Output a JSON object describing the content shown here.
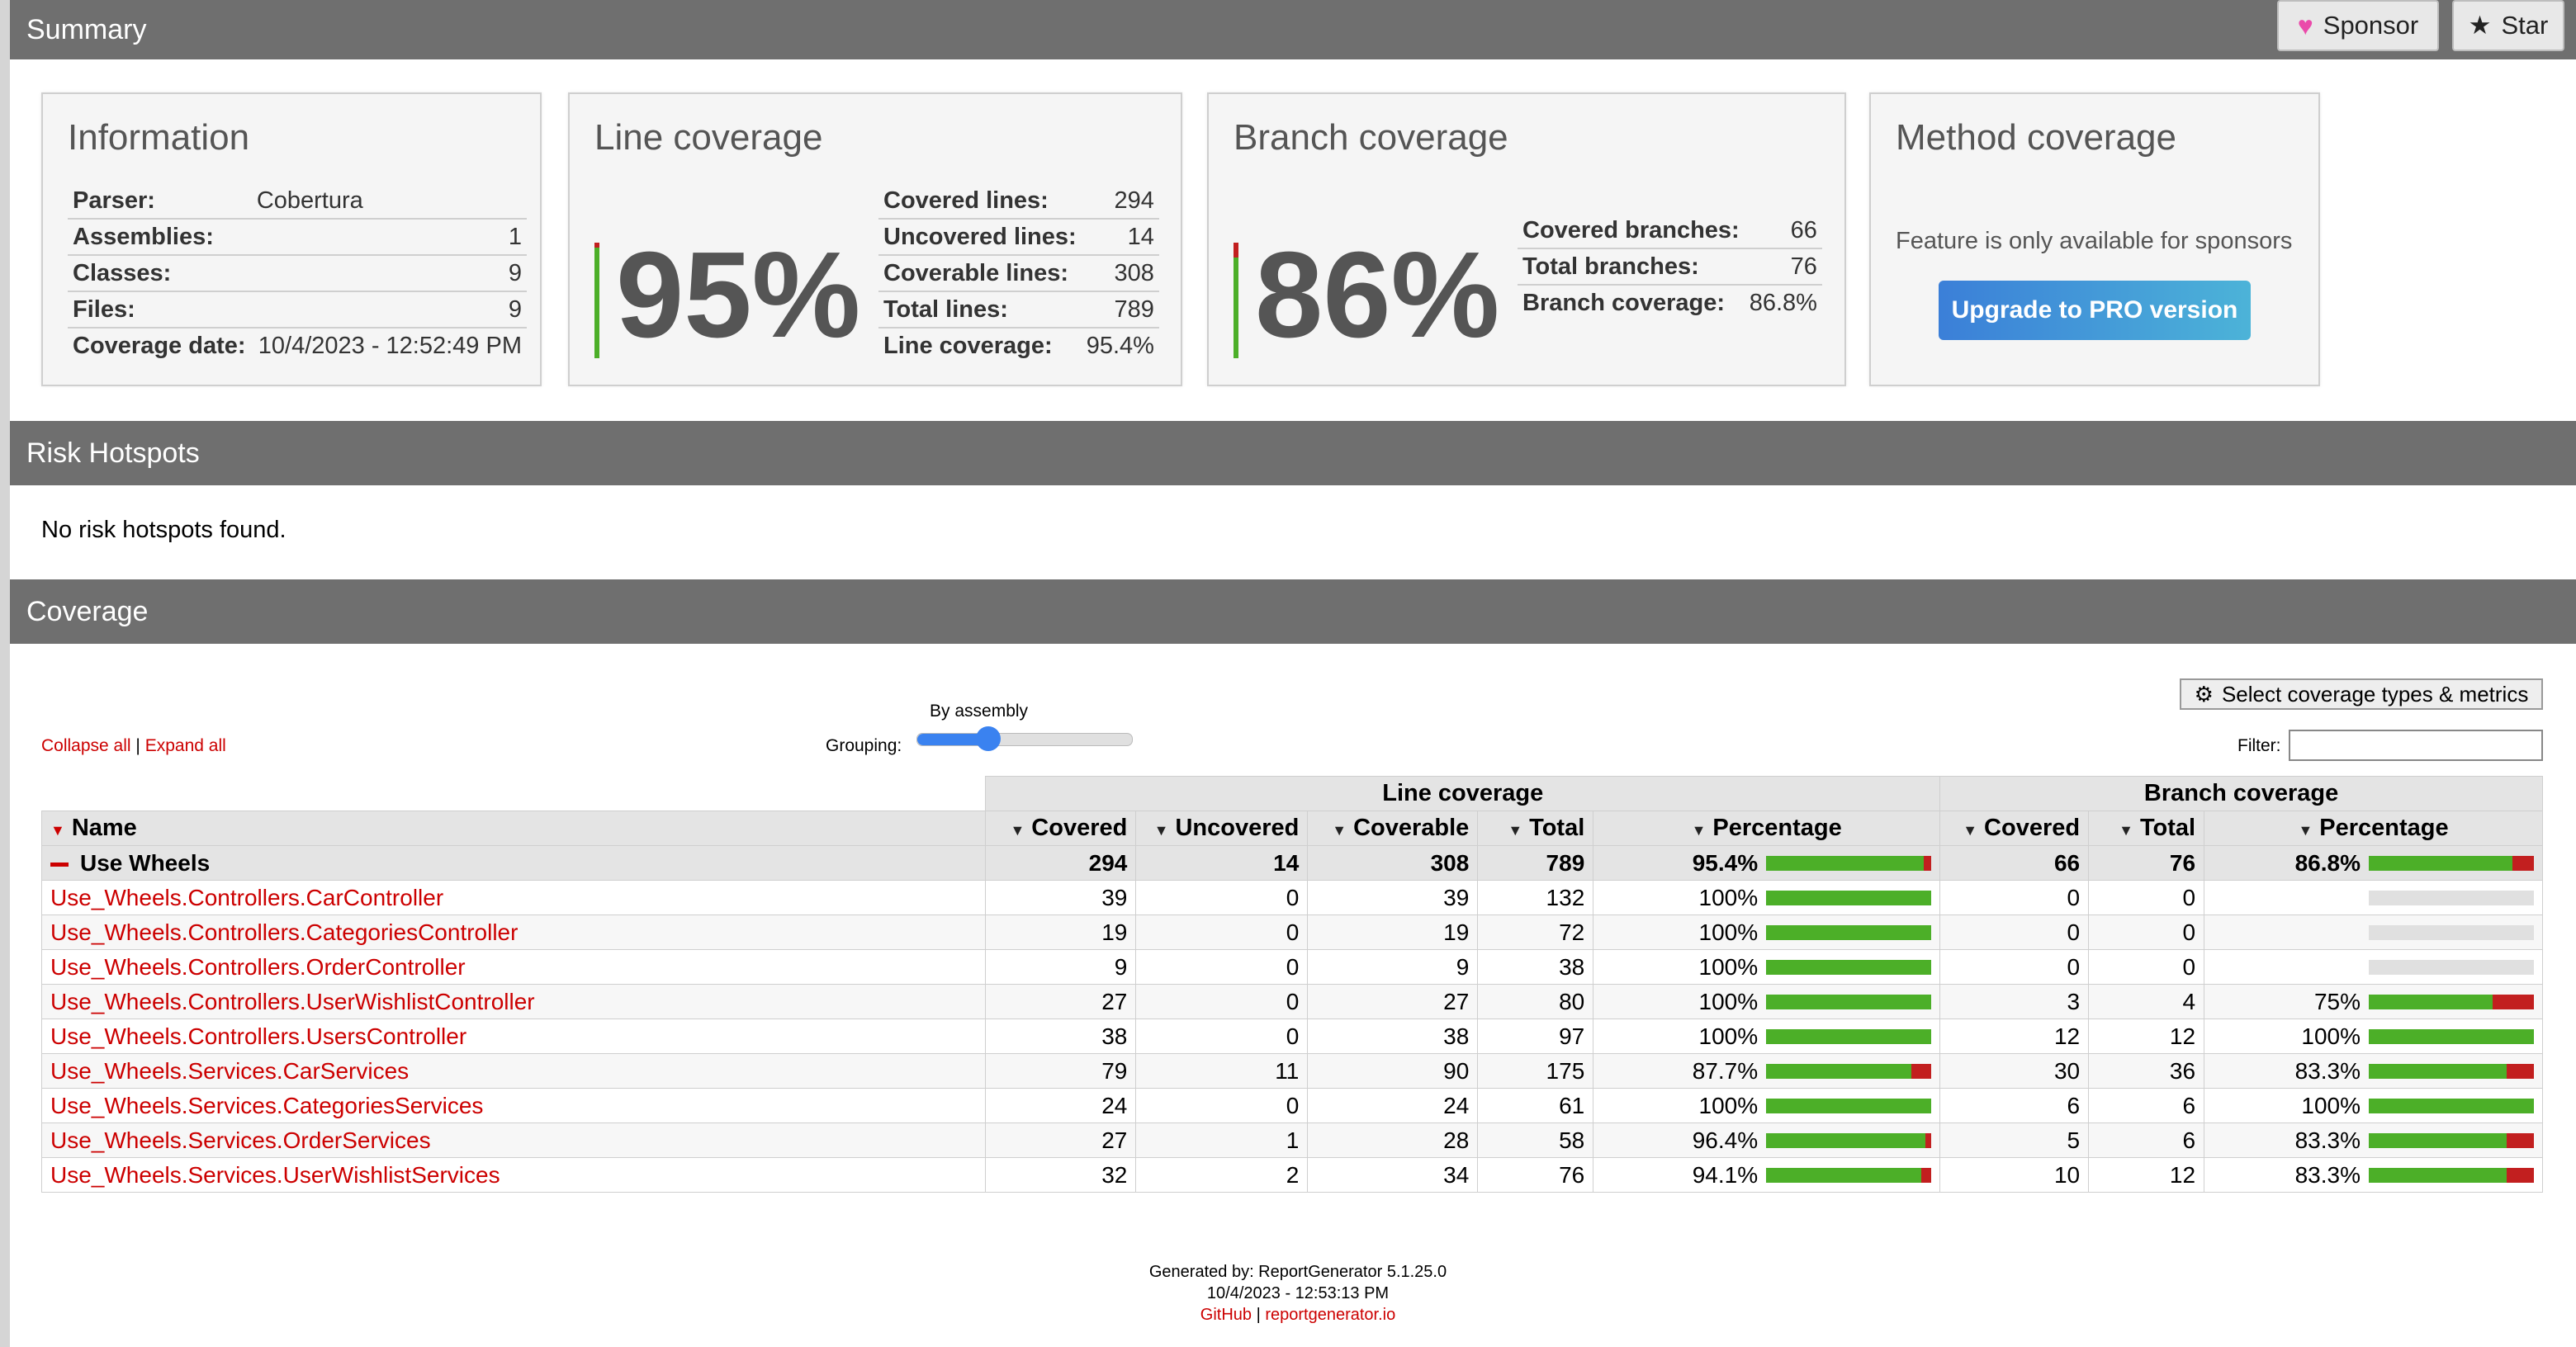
{
  "header": {
    "summary_title": "Summary",
    "sponsor_label": "Sponsor",
    "star_label": "Star",
    "risk_title": "Risk Hotspots",
    "coverage_title": "Coverage"
  },
  "information": {
    "title": "Information",
    "rows": [
      {
        "k": "Parser:",
        "v": "Cobertura"
      },
      {
        "k": "Assemblies:",
        "v": "1"
      },
      {
        "k": "Classes:",
        "v": "9"
      },
      {
        "k": "Files:",
        "v": "9"
      },
      {
        "k": "Coverage date:",
        "v": "10/4/2023 - 12:52:49 PM"
      }
    ]
  },
  "line_coverage": {
    "title": "Line coverage",
    "percent_text": "95%",
    "fraction": 0.954,
    "rows": [
      {
        "k": "Covered lines:",
        "v": "294"
      },
      {
        "k": "Uncovered lines:",
        "v": "14"
      },
      {
        "k": "Coverable lines:",
        "v": "308"
      },
      {
        "k": "Total lines:",
        "v": "789"
      },
      {
        "k": "Line coverage:",
        "v": "95.4%"
      }
    ]
  },
  "branch_coverage": {
    "title": "Branch coverage",
    "percent_text": "86%",
    "fraction": 0.868,
    "rows": [
      {
        "k": "Covered branches:",
        "v": "66"
      },
      {
        "k": "Total branches:",
        "v": "76"
      },
      {
        "k": "Branch coverage:",
        "v": "86.8%"
      }
    ]
  },
  "method_coverage": {
    "title": "Method coverage",
    "text": "Feature is only available for sponsors",
    "button": "Upgrade to PRO version"
  },
  "risk": {
    "text": "No risk hotspots found."
  },
  "controls": {
    "collapse_all": "Collapse all",
    "separator": "|",
    "expand_all": "Expand all",
    "grouping_label": "Grouping:",
    "grouping_value": "By assembly",
    "grouping_level": 0.33,
    "select_metrics": "Select coverage types & metrics",
    "filter_label": "Filter:"
  },
  "table": {
    "group_line": "Line coverage",
    "group_branch": "Branch coverage",
    "columns": [
      "Name",
      "Covered",
      "Uncovered",
      "Coverable",
      "Total",
      "Percentage",
      "Covered",
      "Total",
      "Percentage"
    ],
    "assembly": {
      "name": "Use Wheels",
      "covered": "294",
      "uncovered": "14",
      "coverable": "308",
      "total": "789",
      "pct": "95.4%",
      "line_frac": 0.954,
      "b_covered": "66",
      "b_total": "76",
      "b_pct": "86.8%",
      "branch_frac": 0.868
    },
    "rows": [
      {
        "name": "Use_Wheels.Controllers.CarController",
        "covered": "39",
        "uncovered": "0",
        "coverable": "39",
        "total": "132",
        "pct": "100%",
        "line_frac": 1.0,
        "b_covered": "0",
        "b_total": "0",
        "b_pct": "",
        "branch_frac": null
      },
      {
        "name": "Use_Wheels.Controllers.CategoriesController",
        "covered": "19",
        "uncovered": "0",
        "coverable": "19",
        "total": "72",
        "pct": "100%",
        "line_frac": 1.0,
        "b_covered": "0",
        "b_total": "0",
        "b_pct": "",
        "branch_frac": null
      },
      {
        "name": "Use_Wheels.Controllers.OrderController",
        "covered": "9",
        "uncovered": "0",
        "coverable": "9",
        "total": "38",
        "pct": "100%",
        "line_frac": 1.0,
        "b_covered": "0",
        "b_total": "0",
        "b_pct": "",
        "branch_frac": null
      },
      {
        "name": "Use_Wheels.Controllers.UserWishlistController",
        "covered": "27",
        "uncovered": "0",
        "coverable": "27",
        "total": "80",
        "pct": "100%",
        "line_frac": 1.0,
        "b_covered": "3",
        "b_total": "4",
        "b_pct": "75%",
        "branch_frac": 0.75
      },
      {
        "name": "Use_Wheels.Controllers.UsersController",
        "covered": "38",
        "uncovered": "0",
        "coverable": "38",
        "total": "97",
        "pct": "100%",
        "line_frac": 1.0,
        "b_covered": "12",
        "b_total": "12",
        "b_pct": "100%",
        "branch_frac": 1.0
      },
      {
        "name": "Use_Wheels.Services.CarServices",
        "covered": "79",
        "uncovered": "11",
        "coverable": "90",
        "total": "175",
        "pct": "87.7%",
        "line_frac": 0.877,
        "b_covered": "30",
        "b_total": "36",
        "b_pct": "83.3%",
        "branch_frac": 0.833
      },
      {
        "name": "Use_Wheels.Services.CategoriesServices",
        "covered": "24",
        "uncovered": "0",
        "coverable": "24",
        "total": "61",
        "pct": "100%",
        "line_frac": 1.0,
        "b_covered": "6",
        "b_total": "6",
        "b_pct": "100%",
        "branch_frac": 1.0
      },
      {
        "name": "Use_Wheels.Services.OrderServices",
        "covered": "27",
        "uncovered": "1",
        "coverable": "28",
        "total": "58",
        "pct": "96.4%",
        "line_frac": 0.964,
        "b_covered": "5",
        "b_total": "6",
        "b_pct": "83.3%",
        "branch_frac": 0.833
      },
      {
        "name": "Use_Wheels.Services.UserWishlistServices",
        "covered": "32",
        "uncovered": "2",
        "coverable": "34",
        "total": "76",
        "pct": "94.1%",
        "line_frac": 0.941,
        "b_covered": "10",
        "b_total": "12",
        "b_pct": "83.3%",
        "branch_frac": 0.833
      }
    ]
  },
  "footer": {
    "generated_by": "Generated by: ReportGenerator 5.1.25.0",
    "date": "10/4/2023 - 12:53:13 PM",
    "github": "GitHub",
    "separator": "|",
    "site": "reportgenerator.io"
  },
  "colors": {
    "covered": "#4caf28",
    "uncovered": "#c21f1f",
    "header_bar": "#6f6f6f",
    "link": "#cc0000"
  }
}
